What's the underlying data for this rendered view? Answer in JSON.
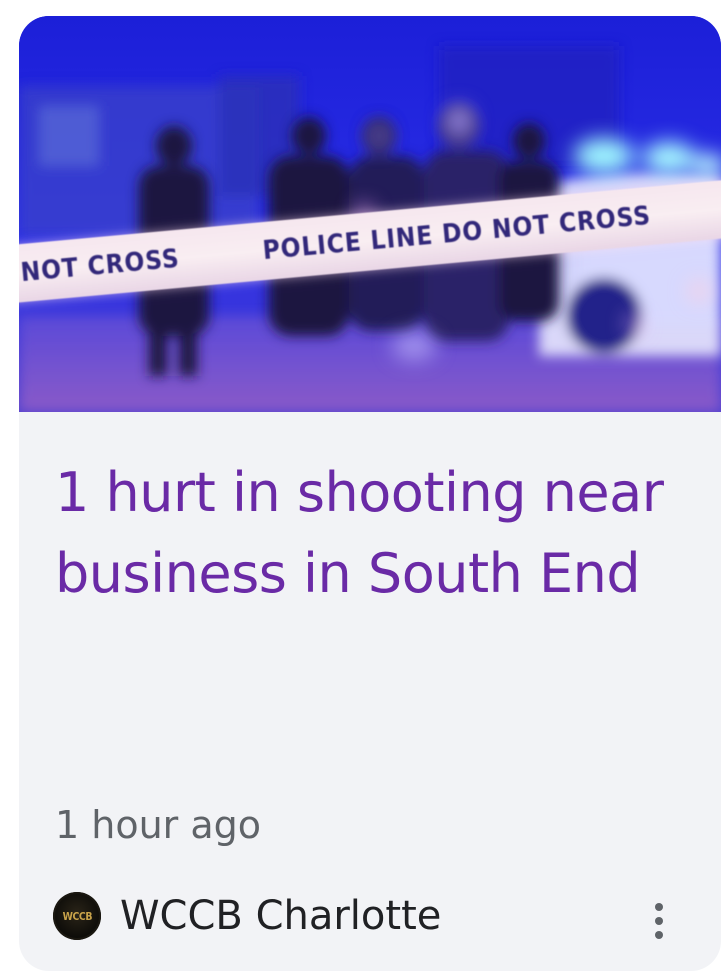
{
  "card": {
    "image": {
      "description_icon": "police-tape-image",
      "tape_text_left": "NOT CROSS",
      "tape_text_right": "POLICE LINE  DO NOT CROSS"
    },
    "headline": "1 hurt in shooting near business in South End",
    "timestamp": "1 hour ago",
    "source": {
      "logo_text": "WCCB",
      "name": "WCCB Charlotte"
    },
    "more_icon": "more-vert-icon"
  },
  "colors": {
    "card_background": "#f2f3f6",
    "headline": "#6a2aa6",
    "timestamp": "#5f6368",
    "source_name": "#202124",
    "image_blue": "#1a1fe0"
  }
}
